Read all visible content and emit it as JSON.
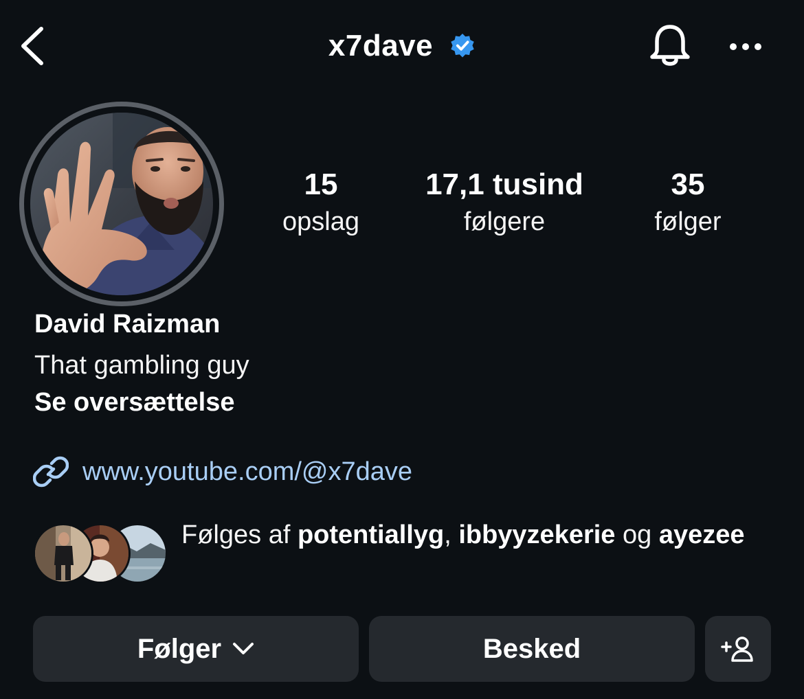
{
  "header": {
    "back_icon": "chevron-left-icon",
    "username": "x7dave",
    "verified_icon": "verified-badge-icon",
    "verified_color": "#3797f0",
    "notifications_icon": "bell-icon",
    "more_icon": "more-horizontal-icon"
  },
  "profile": {
    "avatar_icon": "profile-photo",
    "stats": [
      {
        "value": "15",
        "label": "opslag"
      },
      {
        "value": "17,1 tusind",
        "label": "følgere"
      },
      {
        "value": "35",
        "label": "følger"
      }
    ],
    "full_name": "David Raizman",
    "bio": "That gambling guy",
    "translate_label": "Se oversættelse",
    "link_icon": "link-icon",
    "link": "www.youtube.com/@x7dave",
    "link_color": "#a9cef5"
  },
  "followed_by": {
    "prefix": "Følges af ",
    "users": [
      "potentiallyg",
      "ibbyyzekerie",
      "ayezee"
    ],
    "separator": ", ",
    "conjunction": " og "
  },
  "actions": {
    "follow_label": "Følger",
    "follow_icon": "chevron-down-icon",
    "message_label": "Besked",
    "add_user_icon": "add-person-icon",
    "button_color": "#25292e"
  }
}
